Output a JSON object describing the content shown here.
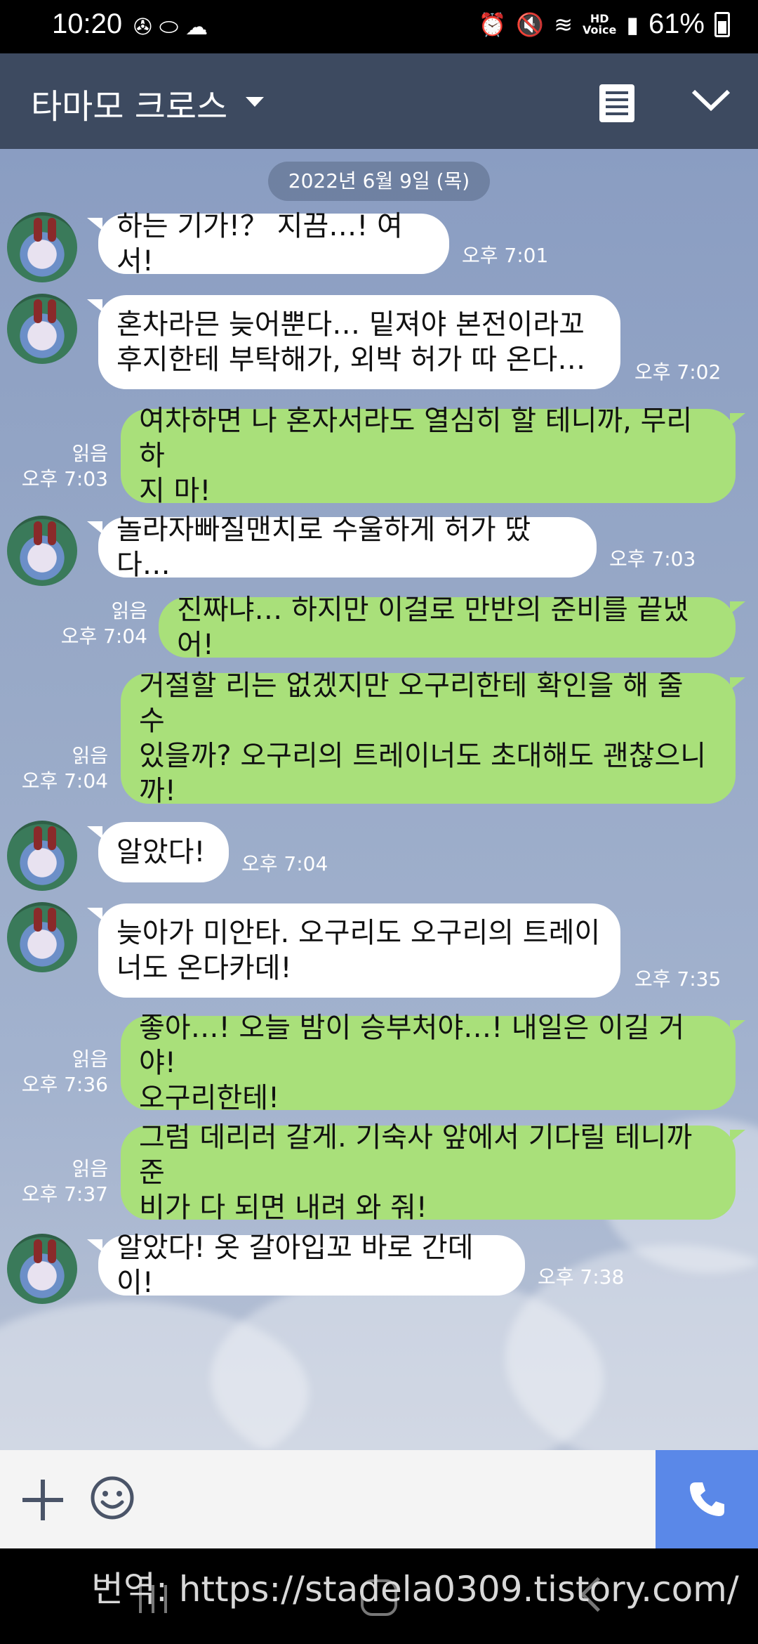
{
  "status_bar": {
    "time": "10:20",
    "battery_percent": "61%",
    "network_label": "HD\nVoice",
    "icons": [
      "aperture-icon",
      "pill-icon",
      "cloud-icon",
      "alarm-icon",
      "mute-icon",
      "wifi-icon",
      "signal-icon",
      "battery-icon"
    ]
  },
  "header": {
    "title": "타마모 크로스",
    "icons": [
      "dropdown-caret-icon",
      "notes-icon",
      "collapse-chevron-icon"
    ]
  },
  "chat": {
    "date": "2022년 6월 9일 (목)",
    "messages": [
      {
        "direction": "in",
        "text": "하는 기가!？ 지끔…! 여서!",
        "time": "오후 7:01"
      },
      {
        "direction": "in",
        "text": "혼차라믄 늦어뿐다… 밑져야 본전이라꼬\n후지한테 부탁해가, 외박 허가 따 온다…",
        "time": "오후 7:02"
      },
      {
        "direction": "out",
        "text": "여차하면 나 혼자서라도 열심히 할 테니까, 무리하\n지 마!",
        "read": "읽음",
        "time": "오후 7:03"
      },
      {
        "direction": "in",
        "text": "놀라자빠질맨치로 수울하게 허가 땄다…",
        "time": "오후 7:03"
      },
      {
        "direction": "out",
        "text": "진짜냐… 하지만 이걸로 만반의 준비를 끝냈어!",
        "read": "읽음",
        "time": "오후 7:04"
      },
      {
        "direction": "out",
        "text": "거절할 리는 없겠지만 오구리한테 확인을 해 줄 수\n있을까?  오구리의 트레이너도 초대해도 괜찮으니\n까!",
        "read": "읽음",
        "time": "오후 7:04"
      },
      {
        "direction": "in",
        "text": "알았다!",
        "time": "오후 7:04"
      },
      {
        "direction": "in",
        "text": "늦아가 미안타. 오구리도 오구리의 트레이\n너도 온다카데!",
        "time": "오후 7:35"
      },
      {
        "direction": "out",
        "text": "좋아…! 오늘 밤이 승부처야…! 내일은 이길 거야!\n오구리한테!",
        "read": "읽음",
        "time": "오후 7:36"
      },
      {
        "direction": "out",
        "text": "그럼 데리러 갈게. 기숙사 앞에서 기다릴 테니까 준\n비가 다 되면 내려 와 줘!",
        "read": "읽음",
        "time": "오후 7:37"
      },
      {
        "direction": "in",
        "text": "알았다! 옷 갈아입꼬 바로 간데이!",
        "time": "오후 7:38"
      }
    ]
  },
  "input_bar": {
    "icons": [
      "plus-icon",
      "emoji-icon",
      "phone-icon"
    ]
  },
  "watermark": "번역: https://stadela0309.tistory.com/",
  "colors": {
    "header_bg": "#3d4a60",
    "outgoing_bubble": "#a9e07a",
    "incoming_bubble": "#ffffff",
    "call_button": "#5a88e8"
  }
}
